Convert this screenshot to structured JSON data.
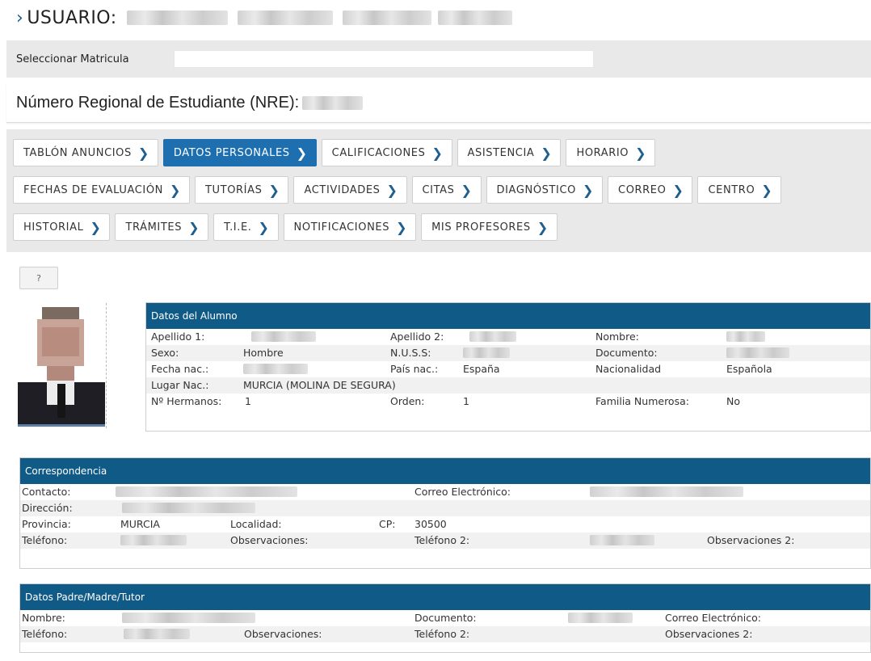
{
  "header": {
    "user_label": "USUARIO:"
  },
  "matricula": {
    "label": "Seleccionar Matricula",
    "value": ""
  },
  "nre": {
    "label": "Número Regional de Estudiante (NRE):"
  },
  "tabs": [
    [
      "TABLÓN ANUNCIOS",
      "DATOS PERSONALES",
      "CALIFICACIONES",
      "ASISTENCIA",
      "HORARIO"
    ],
    [
      "FECHAS DE EVALUACIÓN",
      "TUTORÍAS",
      "ACTIVIDADES",
      "CITAS",
      "DIAGNÓSTICO",
      "CORREO",
      "CENTRO"
    ],
    [
      "HISTORIAL",
      "TRÁMITES",
      "T.I.E.",
      "NOTIFICACIONES",
      "MIS PROFESORES"
    ]
  ],
  "active_tab": "DATOS PERSONALES",
  "help_button": "?",
  "alumno": {
    "title": "Datos del Alumno",
    "apellido1_label": "Apellido 1:",
    "apellido2_label": "Apellido 2:",
    "nombre_label": "Nombre:",
    "sexo_label": "Sexo:",
    "sexo_value": "Hombre",
    "nuss_label": "N.U.S.S:",
    "documento_label": "Documento:",
    "fecha_label": "Fecha nac.:",
    "pais_label": "País nac.:",
    "pais_value": "España",
    "nacionalidad_label": "Nacionalidad",
    "nacionalidad_value": "Española",
    "lugar_label": "Lugar Nac.:",
    "lugar_value": "MURCIA (MOLINA DE SEGURA)",
    "hermanos_label": "Nº Hermanos:",
    "hermanos_value": "1",
    "orden_label": "Orden:",
    "orden_value": "1",
    "familia_label": "Familia Numerosa:",
    "familia_value": "No"
  },
  "correspondencia": {
    "title": "Correspondencia",
    "contacto_label": "Contacto:",
    "correo_label": "Correo Electrónico:",
    "direccion_label": "Dirección:",
    "provincia_label": "Provincia:",
    "provincia_value": "MURCIA",
    "localidad_label": "Localidad:",
    "cp_label": "CP:",
    "cp_value": "30500",
    "telefono_label": "Teléfono:",
    "observaciones_label": "Observaciones:",
    "telefono2_label": "Teléfono 2:",
    "observaciones2_label": "Observaciones 2:"
  },
  "tutor": {
    "title": "Datos Padre/Madre/Tutor",
    "nombre_label": "Nombre:",
    "documento_label": "Documento:",
    "correo_label": "Correo Electrónico:",
    "telefono_label": "Teléfono:",
    "observaciones_label": "Observaciones:",
    "telefono2_label": "Teléfono 2:",
    "observaciones2_label": "Observaciones 2:"
  },
  "colors": {
    "accent": "#1d6fb0",
    "panel_header": "#0f5a87",
    "band": "#e9e9e9"
  }
}
